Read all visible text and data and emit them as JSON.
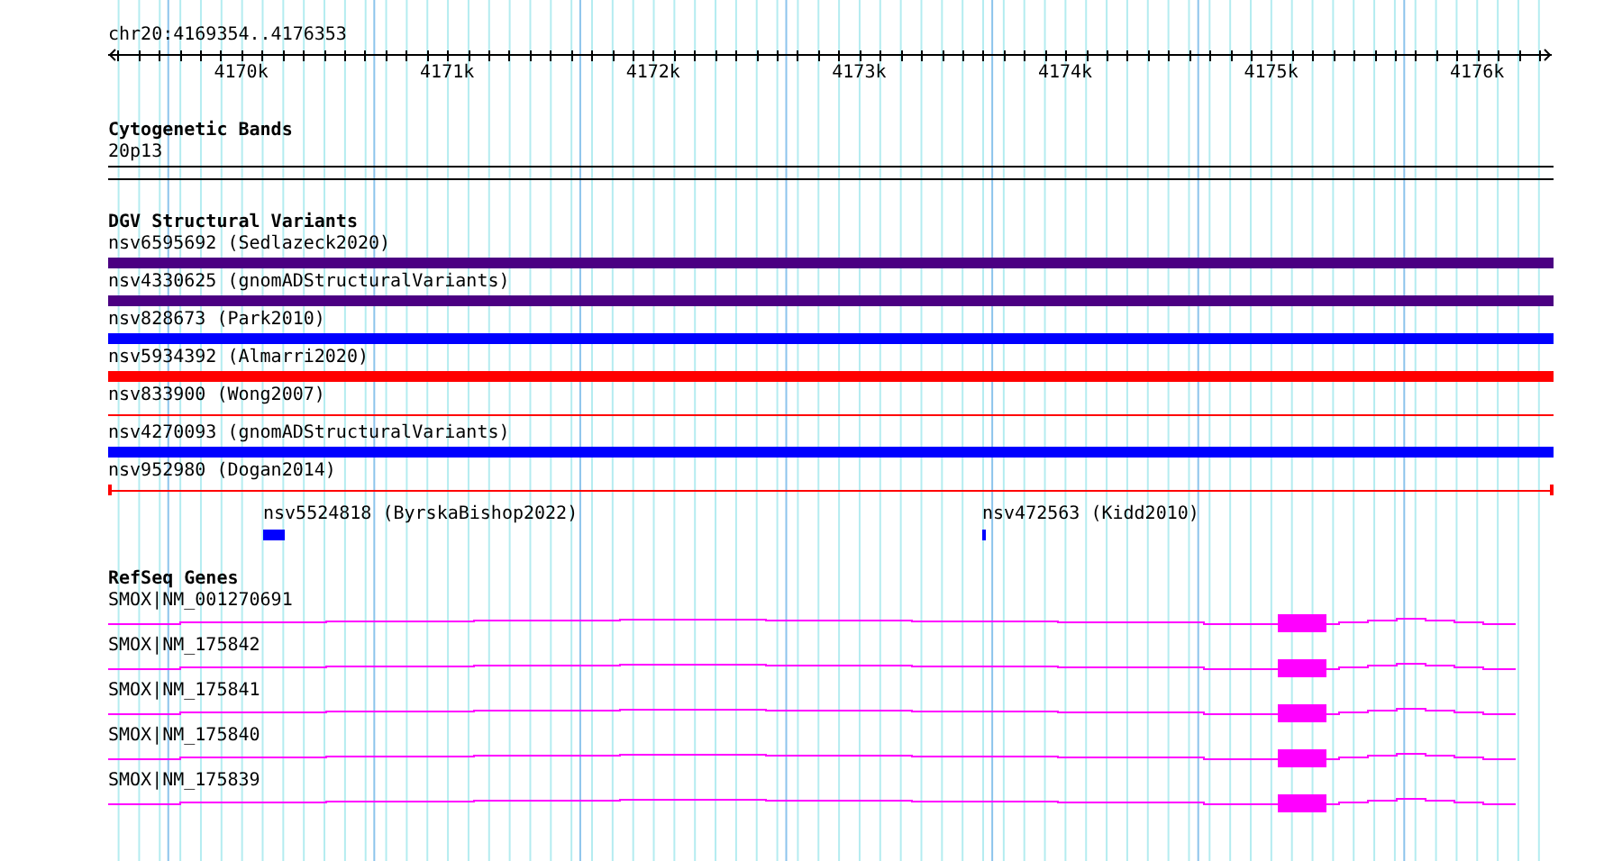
{
  "ruler": {
    "location": "chr20:4169354..4176353",
    "ticks": [
      "4170k",
      "4171k",
      "4172k",
      "4173k",
      "4174k",
      "4175k",
      "4176k"
    ]
  },
  "tracks": [
    {
      "kind": "bands",
      "title": "Cytogenetic Bands",
      "features": [
        {
          "label": "20p13"
        }
      ]
    },
    {
      "kind": "variants",
      "title": "DGV Structural Variants",
      "features": [
        {
          "label": "nsv6595692 (Sedlazeck2020)",
          "color": "#4b0082",
          "kind": "thick"
        },
        {
          "label": "nsv4330625 (gnomADStructuralVariants)",
          "color": "#4b0082",
          "kind": "thick"
        },
        {
          "label": "nsv828673 (Park2010)",
          "color": "#0000ff",
          "kind": "thick"
        },
        {
          "label": "nsv5934392 (Almarri2020)",
          "color": "#ff0000",
          "kind": "thick"
        },
        {
          "label": "nsv833900 (Wong2007)",
          "color": "#ff0000",
          "kind": "thin"
        },
        {
          "label": "nsv4270093 (gnomADStructuralVariants)",
          "color": "#0000ff",
          "kind": "thick"
        },
        {
          "label": "nsv952980 (Dogan2014)",
          "color": "#ff0000",
          "kind": "capped"
        },
        {
          "label": "nsv5524818 (ByrskaBishop2022)",
          "color": "#0000ff",
          "kind": "short"
        },
        {
          "label": "nsv472563 (Kidd2010)",
          "color": "#0000ff",
          "kind": "short"
        }
      ]
    },
    {
      "kind": "genes",
      "title": "RefSeq Genes",
      "features": [
        {
          "label": "SMOX|NM_001270691"
        },
        {
          "label": "SMOX|NM_175842"
        },
        {
          "label": "SMOX|NM_175841"
        },
        {
          "label": "SMOX|NM_175840"
        },
        {
          "label": "SMOX|NM_175839"
        }
      ]
    }
  ]
}
